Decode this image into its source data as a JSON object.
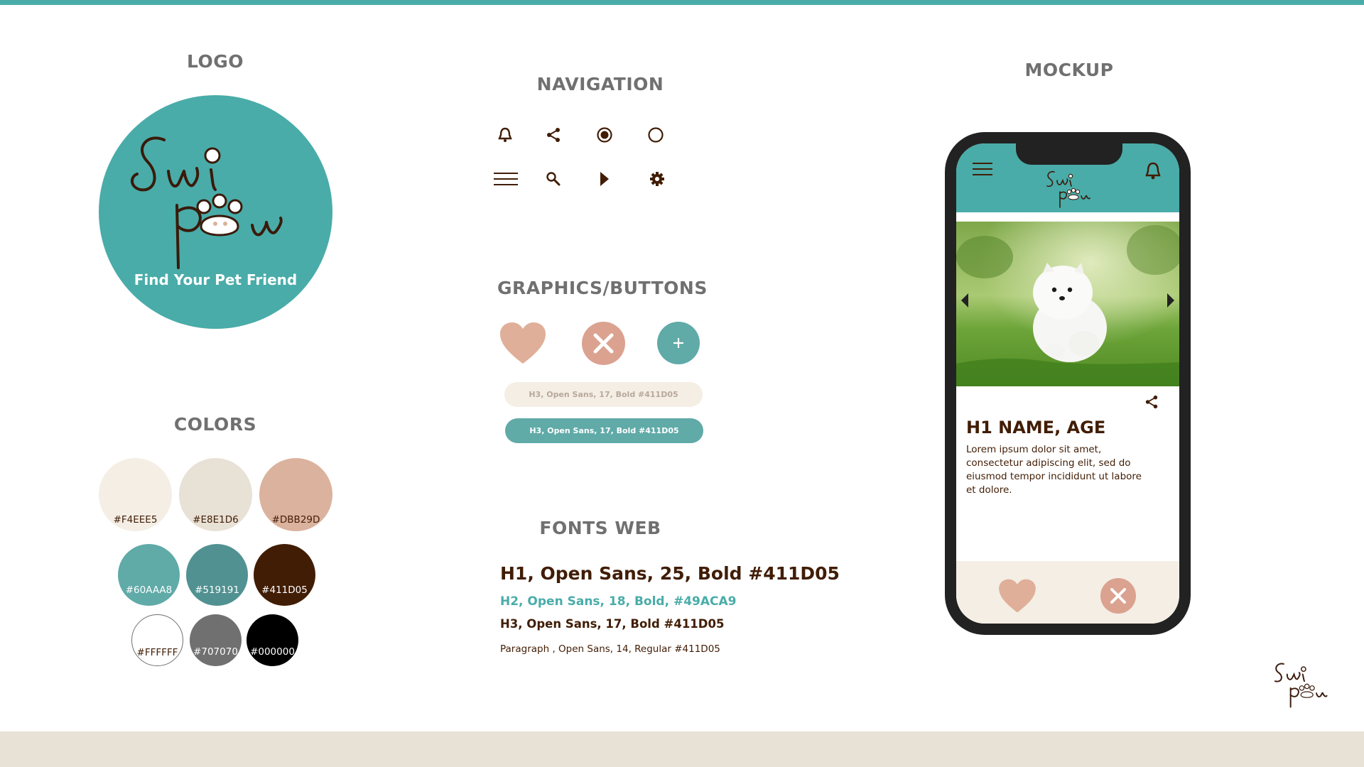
{
  "sections": {
    "logo": "LOGO",
    "navigation": "NAVIGATION",
    "mockup": "MOCKUP",
    "graphics": "GRAPHICS/BUTTONS",
    "colors": "COLORS",
    "fonts": "FONTS WEB"
  },
  "logo": {
    "tagline": "Find Your Pet Friend",
    "wordmark": "Swipaw",
    "bg_color": "#49ACA9"
  },
  "colors": [
    {
      "hex": "#F4EEE5",
      "label": "#F4EEE5"
    },
    {
      "hex": "#E8E1D6",
      "label": "#E8E1D6"
    },
    {
      "hex": "#DBB29D",
      "label": "#DBB29D"
    },
    {
      "hex": "#60AAA8",
      "label": "#60AAA8"
    },
    {
      "hex": "#519191",
      "label": "#519191"
    },
    {
      "hex": "#411D05",
      "label": "#411D05"
    },
    {
      "hex": "#FFFFFF",
      "label": "#FFFFFF"
    },
    {
      "hex": "#707070",
      "label": "#707070"
    },
    {
      "hex": "#000000",
      "label": "#000000"
    }
  ],
  "navigation_icons": [
    "bell-icon",
    "share-icon",
    "radio-selected-icon",
    "radio-empty-icon",
    "menu-icon",
    "search-icon",
    "play-icon",
    "gear-icon"
  ],
  "buttons": {
    "light_pill": "H3, Open Sans, 17, Bold #411D05",
    "teal_pill": "H3, Open Sans, 17, Bold #411D05",
    "icons": [
      "heart-icon",
      "close-icon",
      "plus-icon"
    ]
  },
  "fonts": {
    "h1": "H1, Open Sans, 25, Bold #411D05",
    "h2": "H2, Open Sans, 18, Bold, #49ACA9",
    "h3": "H3, Open Sans, 17, Bold #411D05",
    "p": "Paragraph , Open Sans, 14, Regular #411D05"
  },
  "mockup": {
    "card_title": "H1 NAME, AGE",
    "card_text": "Lorem ipsum dolor sit amet, consectetur adipiscing elit, sed do eiusmod tempor incididunt ut labore et dolore."
  }
}
